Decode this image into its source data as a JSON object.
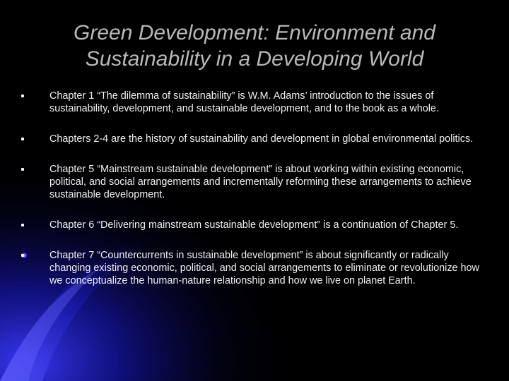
{
  "slide": {
    "title_line1": "Green Development: Environment and",
    "title_line2": "Sustainability in a Developing World",
    "bullets": [
      "Chapter 1 “The dilemma of sustainability” is W.M. Adams’ introduction to the issues of sustainability, development, and sustainable development, and to the book as a whole.",
      "Chapters 2-4 are the history of sustainability and development in global environmental politics.",
      "Chapter 5 “Mainstream sustainable development” is about working within existing economic, political, and social arrangements and incrementally reforming these arrangements to achieve sustainable development.",
      "Chapter 6 “Delivering mainstream sustainable development” is a continuation of Chapter 5.",
      "Chapter 7 “Countercurrents in sustainable development” is about significantly or radically changing existing economic, political, and social arrangements to eliminate or revolutionize how we conceptualize the human-nature relationship and how we live on planet Earth."
    ]
  },
  "colors": {
    "background": "#000000",
    "title": "#b8b8b8",
    "body_text": "#f0f0f0",
    "accent_swoosh": "#1a1aa8"
  }
}
